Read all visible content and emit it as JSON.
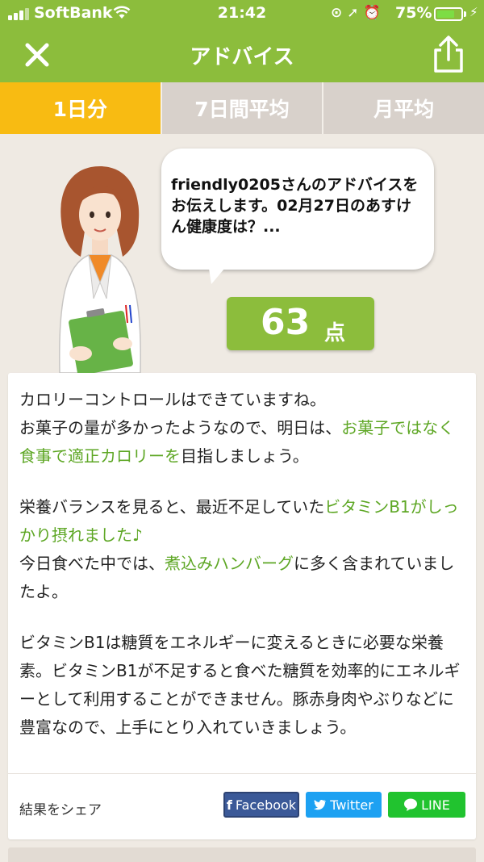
{
  "status_bar": {
    "carrier": "SoftBank",
    "time": "21:42",
    "battery_percent": "75%",
    "battery_level": 0.75,
    "icons": [
      "signal-icon",
      "wifi-icon",
      "rotation-lock-icon",
      "location-icon",
      "alarm-icon",
      "battery-icon",
      "charging-icon"
    ]
  },
  "nav": {
    "title": "アドバイス",
    "close_icon": "close-icon",
    "share_icon": "share-icon"
  },
  "tabs": [
    {
      "label": "1日分",
      "active": true
    },
    {
      "label": "7日間平均",
      "active": false
    },
    {
      "label": "月平均",
      "active": false
    }
  ],
  "advisor": {
    "message": "friendly0205さんのアドバイスをお伝えします。02月27日のあすけん健康度は？...",
    "score_value": "63",
    "score_unit": "点"
  },
  "advice": {
    "p1_line1": "カロリーコントロールはできていますね。",
    "p1_text1": "お菓子の量が多かったようなので、明日は、",
    "p1_highlight": "お菓子ではなく食事で適正カロリーを",
    "p1_text2": "目指しましょう。",
    "p2_text1": "栄養バランスを見ると、最近不足していた",
    "p2_highlight1": "ビタミンB1がしっかり摂れました♪",
    "p2_text2": "今日食べた中では、",
    "p2_highlight2": "煮込みハンバーグ",
    "p2_text3": "に多く含まれていましたよ。",
    "p3": "ビタミンB1は糖質をエネルギーに変えるときに必要な栄養素。ビタミンB1が不足すると食べた糖質を効率的にエネルギーとして利用することができません。豚赤身肉やぶりなどに豊富なので、上手にとり入れていきましょう。"
  },
  "share": {
    "label": "結果をシェア",
    "facebook": "Facebook",
    "twitter": "Twitter",
    "line": "LINE"
  },
  "colors": {
    "brand_green": "#8cbd3c",
    "active_tab": "#f8bb12",
    "inactive_tab": "#d8d1cb",
    "highlight_text": "#5ea725",
    "background": "#efeae3"
  }
}
